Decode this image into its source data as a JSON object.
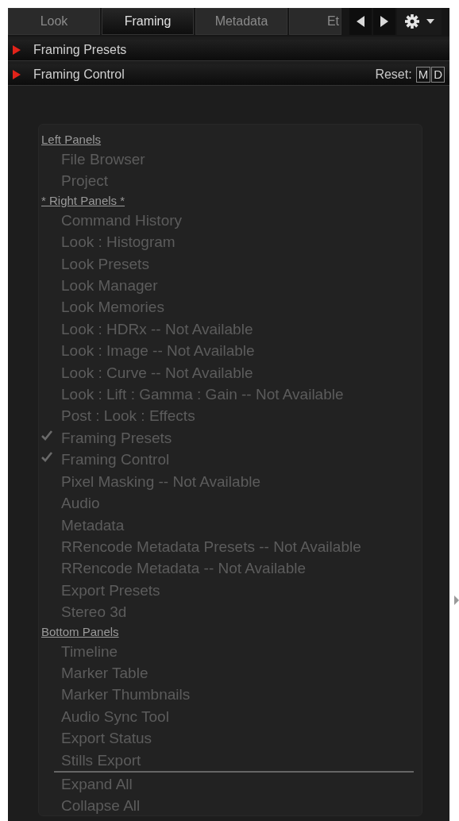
{
  "tabs": [
    {
      "label": "Look",
      "selected": false
    },
    {
      "label": "Framing",
      "selected": true
    },
    {
      "label": "Metadata",
      "selected": false
    },
    {
      "label": "Et",
      "selected": false
    }
  ],
  "sections": [
    {
      "title": "Framing Presets",
      "expanded": false
    },
    {
      "title": "Framing Control",
      "expanded": false,
      "reset_label": "Reset:",
      "reset_buttons": [
        "M",
        "D"
      ]
    }
  ],
  "menu": {
    "groups": [
      {
        "title": "Left Panels",
        "items": [
          {
            "label": "File Browser",
            "checked": false
          },
          {
            "label": "Project",
            "checked": false
          }
        ]
      },
      {
        "title": "* Right Panels *",
        "items": [
          {
            "label": "Command History",
            "checked": false
          },
          {
            "label": "Look : Histogram",
            "checked": false
          },
          {
            "label": "Look Presets",
            "checked": false
          },
          {
            "label": "Look Manager",
            "checked": false
          },
          {
            "label": "Look Memories",
            "checked": false
          },
          {
            "label": "Look : HDRx -- Not Available",
            "checked": false
          },
          {
            "label": "Look : Image -- Not Available",
            "checked": false
          },
          {
            "label": "Look : Curve -- Not Available",
            "checked": false
          },
          {
            "label": "Look : Lift : Gamma : Gain -- Not Available",
            "checked": false
          },
          {
            "label": "Post : Look : Effects",
            "checked": false
          },
          {
            "label": "Framing Presets",
            "checked": true
          },
          {
            "label": "Framing Control",
            "checked": true
          },
          {
            "label": "Pixel Masking -- Not Available",
            "checked": false
          },
          {
            "label": "Audio",
            "checked": false
          },
          {
            "label": "Metadata",
            "checked": false
          },
          {
            "label": "RRencode Metadata Presets -- Not Available",
            "checked": false
          },
          {
            "label": "RRencode Metadata -- Not Available",
            "checked": false
          },
          {
            "label": "Export Presets",
            "checked": false
          },
          {
            "label": "Stereo 3d",
            "checked": false
          }
        ]
      },
      {
        "title": "Bottom Panels",
        "items": [
          {
            "label": "Timeline",
            "checked": false
          },
          {
            "label": "Marker Table",
            "checked": false
          },
          {
            "label": "Marker Thumbnails",
            "checked": false
          },
          {
            "label": "Audio Sync Tool",
            "checked": false
          },
          {
            "label": "Export Status",
            "checked": false
          },
          {
            "label": "Stills Export",
            "checked": false
          }
        ]
      }
    ],
    "actions": [
      "Expand All",
      "Collapse All"
    ]
  }
}
